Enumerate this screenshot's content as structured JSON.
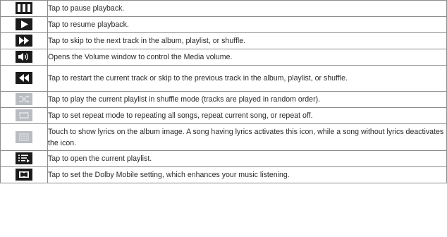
{
  "table": {
    "rows": [
      {
        "icon": "pause-icon",
        "text": "Tap to pause playback."
      },
      {
        "icon": "play-icon",
        "text": "Tap to resume playback."
      },
      {
        "icon": "fast-forward-icon",
        "text": "Tap to skip to the next track in the album, playlist, or shuffle."
      },
      {
        "icon": "volume-icon",
        "text": "Opens the Volume window to control the Media volume."
      },
      {
        "icon": "rewind-icon",
        "text": "Tap to restart the current track or skip to the previous track in the album, playlist, or shuffle."
      },
      {
        "icon": "shuffle-icon",
        "text": "Tap to play the current playlist in shuffle mode (tracks are played in random order)."
      },
      {
        "icon": "repeat-icon",
        "text": "Tap to set repeat mode to repeating all songs, repeat current song, or repeat off."
      },
      {
        "icon": "lyrics-icon",
        "text": "Touch to show lyrics on the album image. A song having lyrics activates this icon, while a song without lyrics deactivates the icon."
      },
      {
        "icon": "playlist-icon",
        "text": "Tap to open the current playlist."
      },
      {
        "icon": "dolby-icon",
        "text": "Tap to set the Dolby Mobile setting, which enhances your music listening."
      }
    ]
  }
}
